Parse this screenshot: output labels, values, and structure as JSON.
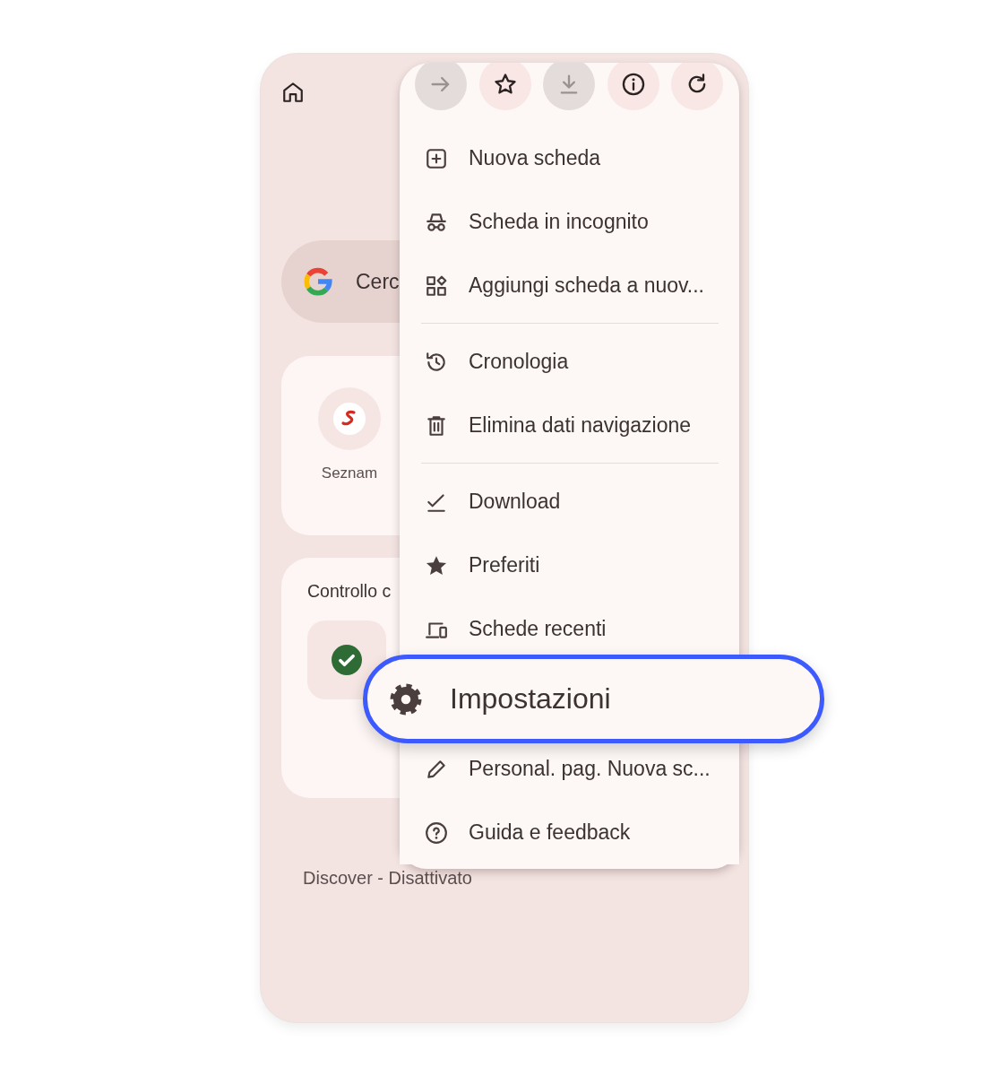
{
  "search_bar": {
    "text": "Cerc"
  },
  "shortcuts": [
    {
      "label": "Seznam"
    }
  ],
  "safety_check": {
    "title": "Controllo c"
  },
  "discover_status": "Discover - Disattivato",
  "menu": {
    "toolbar": [
      {
        "kind": "forward",
        "disabled": true
      },
      {
        "kind": "bookmark",
        "disabled": false
      },
      {
        "kind": "download",
        "disabled": true
      },
      {
        "kind": "info",
        "disabled": false
      },
      {
        "kind": "reload",
        "disabled": false
      }
    ],
    "sections": [
      [
        {
          "kind": "new-tab",
          "label": "Nuova scheda",
          "highlighted": false
        },
        {
          "kind": "incognito",
          "label": "Scheda in incognito",
          "highlighted": false
        },
        {
          "kind": "group",
          "label": "Aggiungi scheda a nuov...",
          "highlighted": false
        }
      ],
      [
        {
          "kind": "history",
          "label": "Cronologia",
          "highlighted": false
        },
        {
          "kind": "trash",
          "label": "Elimina dati navigazione",
          "highlighted": false
        }
      ],
      [
        {
          "kind": "downloads",
          "label": "Download",
          "highlighted": false
        },
        {
          "kind": "star",
          "label": "Preferiti",
          "highlighted": false
        },
        {
          "kind": "devices",
          "label": "Schede recenti",
          "highlighted": false
        },
        {
          "kind": "settings",
          "label": "Impostazioni",
          "highlighted": true
        },
        {
          "kind": "pencil",
          "label": "Personal. pag. Nuova sc...",
          "highlighted": false
        },
        {
          "kind": "help",
          "label": "Guida e feedback",
          "highlighted": false
        }
      ]
    ]
  }
}
